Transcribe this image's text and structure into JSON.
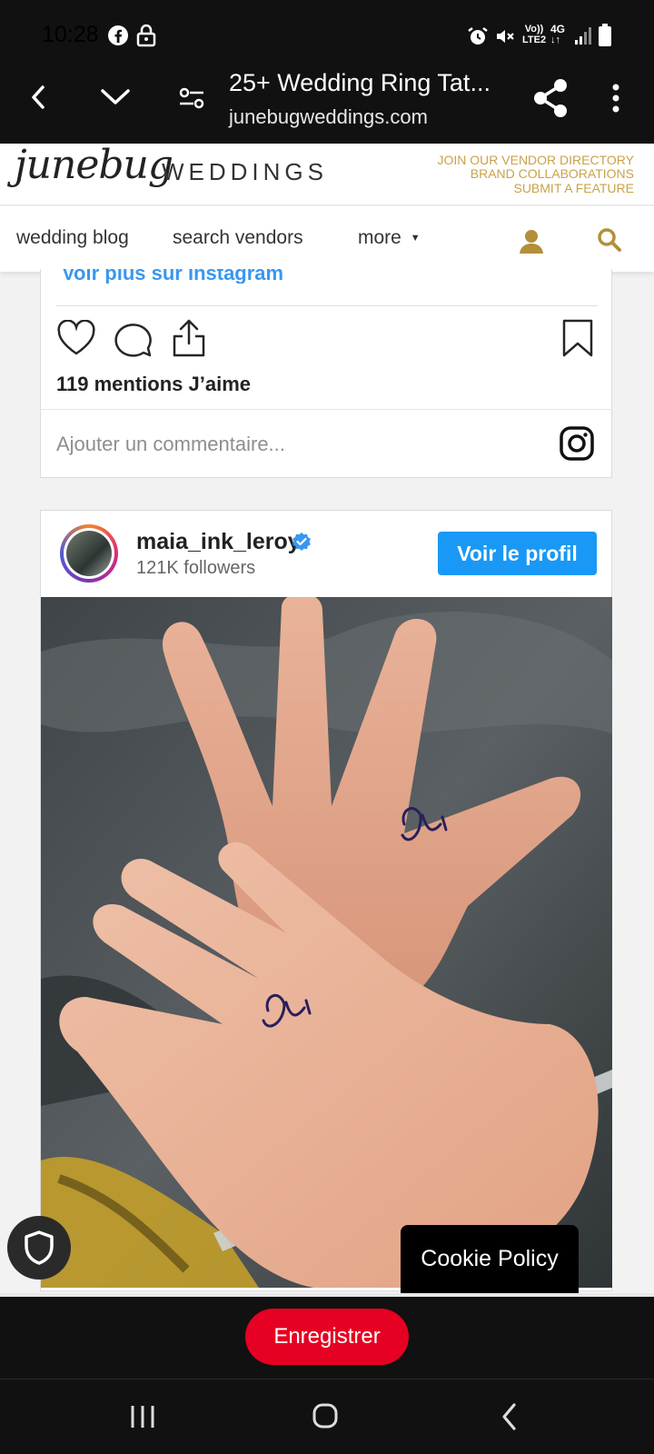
{
  "status_bar": {
    "time": "10:28",
    "network_label_1": "Vo))",
    "network_label_2": "LTE2",
    "network_type": "4G",
    "icons": [
      "facebook-icon",
      "lock-icon",
      "alarm-icon",
      "mute-icon",
      "signal-icon",
      "battery-icon"
    ]
  },
  "browser": {
    "page_title": "25+ Wedding Ring Tat...",
    "domain": "junebugweddings.com"
  },
  "site": {
    "logo_script": "junebug",
    "logo_text": "WEDDINGS",
    "vendor_links": [
      "JOIN OUR VENDOR DIRECTORY",
      "BRAND COLLABORATIONS",
      "SUBMIT A FEATURE"
    ],
    "nav": {
      "blog": "wedding blog",
      "vendors": "search vendors",
      "more": "more"
    },
    "accent_color": "#c9a24a"
  },
  "post1": {
    "see_more": "Voir plus sur Instagram",
    "likes": "119 mentions J’aime",
    "comment_placeholder": "Ajouter un commentaire..."
  },
  "post2": {
    "username": "maia_ink_leroy",
    "followers": "121K followers",
    "profile_button": "Voir le profil",
    "verified": true
  },
  "floating": {
    "cookie_policy": "Cookie Policy"
  },
  "pinterest": {
    "save_label": "Enregistrer",
    "save_color": "#e60023"
  }
}
